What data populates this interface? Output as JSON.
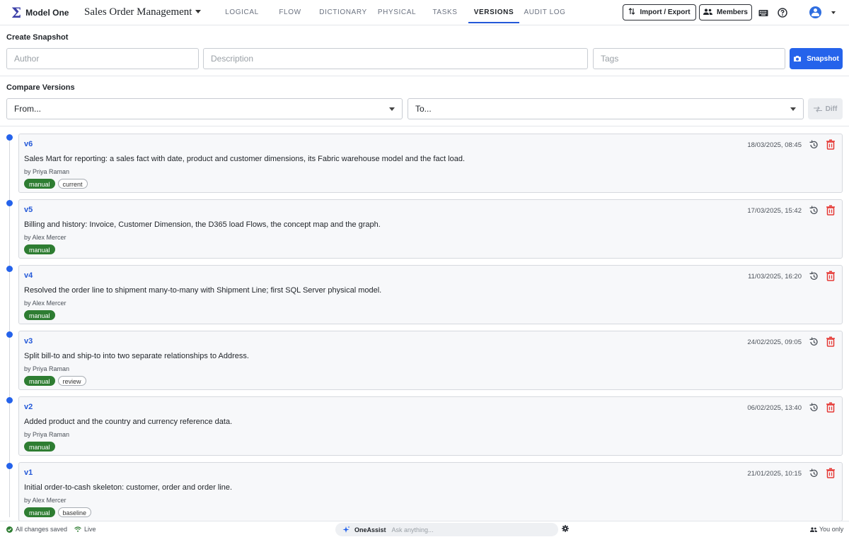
{
  "app": {
    "logo_glyph": "Σ",
    "name": "Model One",
    "model_name": "Sales Order Management"
  },
  "tabs": [
    {
      "label": "LOGICAL",
      "active": false
    },
    {
      "label": "FLOW",
      "active": false
    },
    {
      "label": "DICTIONARY",
      "active": false
    },
    {
      "label": "PHYSICAL",
      "active": false
    },
    {
      "label": "TASKS",
      "active": false
    },
    {
      "label": "VERSIONS",
      "active": true
    },
    {
      "label": "AUDIT LOG",
      "active": false
    }
  ],
  "toolbar": {
    "import_export_label": "Import / Export",
    "members_label": "Members",
    "icons": [
      "keyboard-icon",
      "help-icon",
      "user-avatar-icon"
    ]
  },
  "create_snapshot": {
    "title": "Create Snapshot",
    "author_placeholder": "Author",
    "description_placeholder": "Description",
    "tags_placeholder": "Tags",
    "button_label": "Snapshot"
  },
  "compare": {
    "title": "Compare Versions",
    "from_value": "From...",
    "to_value": "To...",
    "diff_label": "Diff"
  },
  "versions": [
    {
      "version": "v6",
      "description": "Sales Mart for reporting: a sales fact with date, product and customer dimensions, its Fabric warehouse model and the fact load.",
      "author": "by Priya Raman",
      "date": "18/03/2025, 08:45",
      "tags": [
        "manual",
        "current"
      ]
    },
    {
      "version": "v5",
      "description": "Billing and history: Invoice, Customer Dimension, the D365 load Flows, the concept map and the graph.",
      "author": "by Alex Mercer",
      "date": "17/03/2025, 15:42",
      "tags": [
        "manual"
      ]
    },
    {
      "version": "v4",
      "description": "Resolved the order line to shipment many-to-many with Shipment Line; first SQL Server physical model.",
      "author": "by Alex Mercer",
      "date": "11/03/2025, 16:20",
      "tags": [
        "manual"
      ]
    },
    {
      "version": "v3",
      "description": "Split bill-to and ship-to into two separate relationships to Address.",
      "author": "by Priya Raman",
      "date": "24/02/2025, 09:05",
      "tags": [
        "manual",
        "review"
      ]
    },
    {
      "version": "v2",
      "description": "Added product and the country and currency reference data.",
      "author": "by Priya Raman",
      "date": "06/02/2025, 13:40",
      "tags": [
        "manual"
      ]
    },
    {
      "version": "v1",
      "description": "Initial order-to-cash skeleton: customer, order and order line.",
      "author": "by Alex Mercer",
      "date": "21/01/2025, 10:15",
      "tags": [
        "manual",
        "baseline"
      ]
    }
  ],
  "status_bar": {
    "saved": "All changes saved",
    "live": "Live",
    "assistant_name": "OneAssist",
    "assistant_placeholder": "Ask anything...",
    "visibility": "You only"
  },
  "colors": {
    "accent": "#2563eb",
    "tag_green": "#2e7d32",
    "delete_red": "#e53935"
  }
}
